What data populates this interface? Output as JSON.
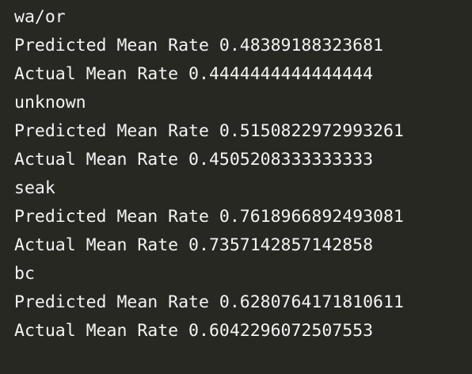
{
  "terminal": {
    "lines": [
      "wa/or",
      "Predicted Mean Rate 0.48389188323681",
      "Actual Mean Rate 0.4444444444444444",
      "unknown",
      "Predicted Mean Rate 0.5150822972993261",
      "Actual Mean Rate 0.4505208333333333",
      "seak",
      "Predicted Mean Rate 0.7618966892493081",
      "Actual Mean Rate 0.7357142857142858",
      "bc",
      "Predicted Mean Rate 0.6280764171810611",
      "Actual Mean Rate 0.6042296072507553"
    ]
  }
}
